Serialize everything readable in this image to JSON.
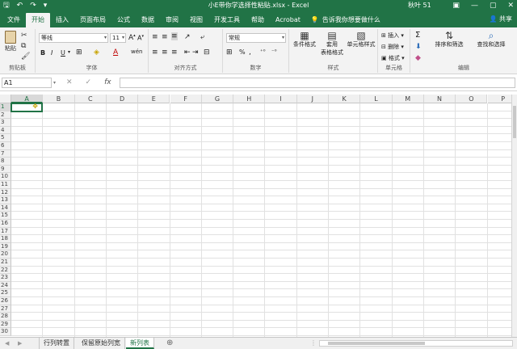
{
  "titlebar": {
    "save_icon": "save-icon",
    "undo_icon": "undo-icon",
    "redo_icon": "redo-icon",
    "customize_icon": "customize-qat-icon",
    "title": "小E带你学选择性粘贴.xlsx  -  Excel",
    "user": "秋叶 51",
    "minimize": "—",
    "restore": "▢",
    "close": "✕",
    "ribbon_options": "▣"
  },
  "tabs": [
    {
      "label": "文件"
    },
    {
      "label": "开始"
    },
    {
      "label": "插入"
    },
    {
      "label": "页面布局"
    },
    {
      "label": "公式"
    },
    {
      "label": "数据"
    },
    {
      "label": "审阅"
    },
    {
      "label": "视图"
    },
    {
      "label": "开发工具"
    },
    {
      "label": "帮助"
    },
    {
      "label": "Acrobat"
    }
  ],
  "tellme": "告诉我你想要做什么",
  "share": "共享",
  "ribbon": {
    "clipboard": {
      "paste": "粘贴",
      "label": "剪贴板"
    },
    "font": {
      "name": "等线",
      "size": "11",
      "bold": "B",
      "italic": "I",
      "underline": "U",
      "grow": "A",
      "shrink": "A",
      "wen": "wén",
      "label": "字体"
    },
    "alignment": {
      "label": "对齐方式"
    },
    "number": {
      "format": "常规",
      "percent": "%",
      "comma": ",",
      "label": "数字"
    },
    "styles": {
      "conditional": "条件格式",
      "table1": "套用",
      "table2": "表格格式",
      "cell": "单元格样式",
      "label": "样式"
    },
    "cells": {
      "insert": "插入",
      "delete": "删除",
      "format": "格式",
      "label": "单元格"
    },
    "editing": {
      "sum": "Σ",
      "sort": "排序和筛选",
      "find": "查找和选择",
      "label": "编辑"
    }
  },
  "formula_bar": {
    "name_box": "A1",
    "cancel": "✕",
    "enter": "✓",
    "fx": "fx",
    "value": ""
  },
  "columns": [
    "A",
    "B",
    "C",
    "D",
    "E",
    "F",
    "G",
    "H",
    "I",
    "J",
    "K",
    "L",
    "M",
    "N",
    "O",
    "P"
  ],
  "rows": [
    "1",
    "2",
    "3",
    "4",
    "5",
    "6",
    "7",
    "8",
    "9",
    "10",
    "11",
    "12",
    "13",
    "14",
    "15",
    "16",
    "17",
    "18",
    "19",
    "20",
    "21",
    "22",
    "23",
    "24",
    "25",
    "26",
    "27",
    "28",
    "29",
    "30"
  ],
  "selected_cell": "A1",
  "sheets": [
    {
      "label": "行列转置"
    },
    {
      "label": "保留原始列宽"
    },
    {
      "label": "新列表"
    }
  ],
  "active_sheet": "新列表",
  "add_sheet": "⊕",
  "colors": {
    "accent": "#217346",
    "ribbon_bg": "#f3f3f3",
    "grid_line": "#e1e1e1"
  }
}
